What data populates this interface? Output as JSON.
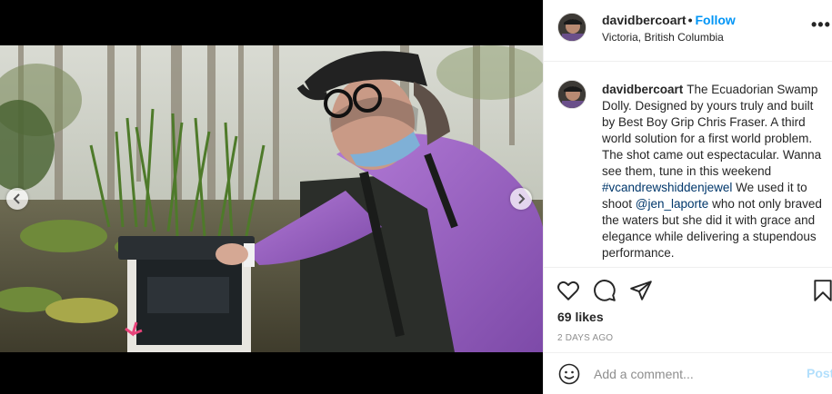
{
  "post": {
    "username": "davidbercoart",
    "follow_label": "Follow",
    "location": "Victoria, British Columbia",
    "more_icon": "more-horizontal-icon"
  },
  "caption": {
    "username": "davidbercoart",
    "text_1": "The Ecuadorian Swamp Dolly. Designed by yours truly and built by Best Boy Grip Chris Fraser. A third world solution for a first world problem. The shot came out espectacular. Wanna see them, tune in this weekend",
    "hashtag": "#vcandrewshiddenjewel",
    "text_2": "We used it to shoot",
    "mention": "@jen_laporte",
    "text_3": "who not only braved the waters but she did it with grace and elegance while delivering a stupendous performance."
  },
  "actions": {
    "likes": "69 likes",
    "date": "2 DAYS AGO",
    "icons": [
      "heart-icon",
      "comment-icon",
      "share-icon",
      "bookmark-icon"
    ]
  },
  "comment_box": {
    "placeholder": "Add a comment...",
    "post_label": "Post",
    "emoji_icon": "emoji-icon"
  },
  "colors": {
    "accent": "#0095f6",
    "link": "#00376b",
    "post_disabled": "#b2dffc",
    "muted": "#8e8e8e"
  }
}
